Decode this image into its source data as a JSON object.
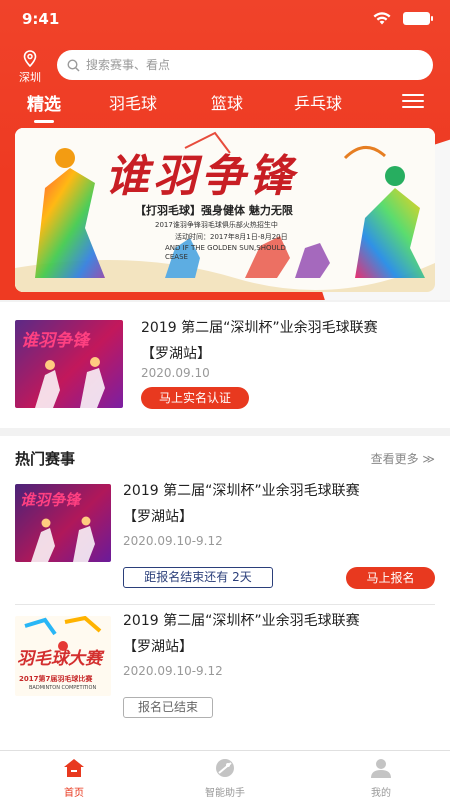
{
  "status_bar": {
    "time": "9:41"
  },
  "location": {
    "city": "深圳"
  },
  "search": {
    "placeholder": "搜索赛事、看点"
  },
  "tabs": [
    {
      "label": "精选",
      "active": true
    },
    {
      "label": "羽毛球",
      "active": false
    },
    {
      "label": "篮球",
      "active": false
    },
    {
      "label": "乒乓球",
      "active": false
    }
  ],
  "banner": {
    "title": "谁羽争锋",
    "subtitle": "【打羽毛球】强身健体 魅力无限",
    "line2": "2017谁羽争锋羽毛球俱乐部火热招生中",
    "line3": "活动时间：2017年8月1日-8月20日",
    "line4": "AND IF THE GOLDEN SUN,SHOULD CEASE"
  },
  "featured_event": {
    "title_line1": "2019 第二届“深圳杯”业余羽毛球联赛",
    "title_line2": "【罗湖站】",
    "date": "2020.09.10",
    "action_label": "马上实名认证"
  },
  "hot_section": {
    "title": "热门赛事",
    "more_label": "查看更多 ≫",
    "events": [
      {
        "title_line1": "2019 第二届“深圳杯”业余羽毛球联赛",
        "title_line2": "【罗湖站】",
        "date": "2020.09.10-9.12",
        "status_label": "距报名结束还有  2天",
        "action_label": "马上报名",
        "thumb_text": "谁羽争锋"
      },
      {
        "title_line1": "2019 第二届“深圳杯”业余羽毛球联赛",
        "title_line2": "【罗湖站】",
        "date": "2020.09.10-9.12",
        "status_label": "报名已结束",
        "thumb_text": "羽毛球大赛",
        "thumb_sub": "2017第7届羽毛球比赛",
        "thumb_sub2": "BADMINTON COMPETITION"
      }
    ]
  },
  "featured_thumb": {
    "thumb_text": "谁羽争锋"
  },
  "tab_bar": [
    {
      "label": "首页",
      "icon": "home-icon",
      "active": true
    },
    {
      "label": "智能助手",
      "icon": "assistant-icon",
      "active": false
    },
    {
      "label": "我的",
      "icon": "profile-icon",
      "active": false
    }
  ],
  "colors": {
    "brand": "#ee3a22",
    "accent": "#e8391f",
    "navy": "#2b3f7a"
  }
}
